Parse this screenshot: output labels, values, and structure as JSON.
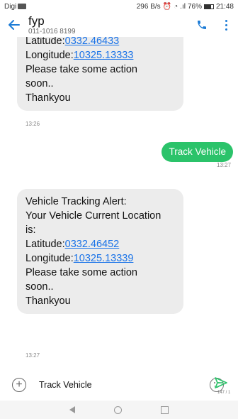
{
  "status_bar": {
    "carrier": "Digi",
    "speed": "296 B/s",
    "signal": ".ıl",
    "battery": "76%",
    "battery_level": 0.76,
    "time": "21:48"
  },
  "header": {
    "contact_name": "fyp",
    "contact_number": "011-1016 8199",
    "back_icon": "back-arrow-icon",
    "call_icon": "phone-icon",
    "more_icon": "more-vertical-icon"
  },
  "messages": [
    {
      "type": "incoming",
      "lines": [
        {
          "text": "Latitude:",
          "link": "0332.46433"
        },
        {
          "text": "Longitude:",
          "link": "10325.13333"
        },
        {
          "text": "Please take some action"
        },
        {
          "text": "soon.."
        },
        {
          "text": "Thankyou"
        }
      ],
      "time": "13:26"
    },
    {
      "type": "outgoing",
      "text": "Track Vehicle",
      "time": "13:27"
    },
    {
      "type": "incoming",
      "lines": [
        {
          "text": "Vehicle Tracking Alert:"
        },
        {
          "text": "Your Vehicle Current Location"
        },
        {
          "text": "is:"
        },
        {
          "text": "Latitude:",
          "link": "0332.46452"
        },
        {
          "text": "Longitude:",
          "link": "10325.13339"
        },
        {
          "text": "Please take some action"
        },
        {
          "text": "soon.."
        },
        {
          "text": "Thankyou"
        }
      ],
      "time": "13:27"
    }
  ],
  "compose": {
    "value": "Track Vehicle",
    "char_count": "147 / 1"
  },
  "colors": {
    "accent": "#1d7cd6",
    "outgoing_bubble": "#2bc36a",
    "incoming_bubble": "#ececec",
    "link": "#1a73e8"
  }
}
